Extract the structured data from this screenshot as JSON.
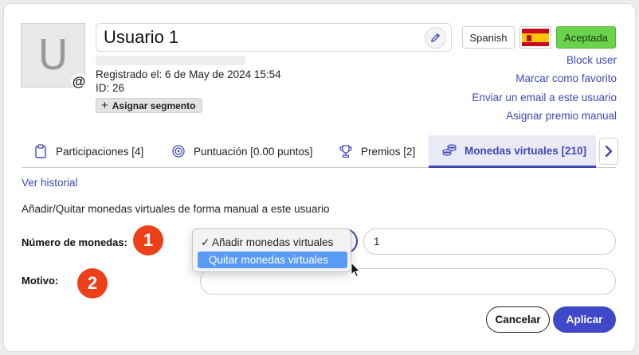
{
  "user": {
    "avatar_letter": "U",
    "name": "Usuario 1",
    "registered": "Registrado el: 6 de May de 2024 15:54",
    "id": "ID: 26",
    "segment_button": "Asignar segmento"
  },
  "header_actions": {
    "language": "Spanish",
    "status": "Aceptada",
    "status_color": "#6ad24b",
    "links": [
      "Block user",
      "Marcar como favorito",
      "Enviar un email a este usuario",
      "Asignar premio manual"
    ]
  },
  "tabs": [
    {
      "label": "Participaciones [4]",
      "icon": "clipboard-icon"
    },
    {
      "label": "Puntuación [0.00 puntos]",
      "icon": "target-icon"
    },
    {
      "label": "Premios [2]",
      "icon": "trophy-icon"
    },
    {
      "label": "Monedas virtuales [210]",
      "icon": "coins-icon",
      "active": true
    }
  ],
  "main": {
    "history_link": "Ver historial",
    "description": "Añadir/Quitar monedas virtuales de forma manual a este usuario",
    "coins_label": "Número de monedas:",
    "reason_label": "Motivo:",
    "dropdown_options": [
      "Añadir monedas virtuales",
      "Quitar monedas virtuales"
    ],
    "dropdown_checked": "✓",
    "amount_value": "1",
    "reason_value": "",
    "marker_1": "1",
    "marker_2": "2",
    "cancel_button": "Cancelar",
    "apply_button": "Aplicar"
  },
  "colors": {
    "accent": "#3f48b5",
    "marker": "#ee3f1b",
    "highlight": "#5a9cf5"
  }
}
